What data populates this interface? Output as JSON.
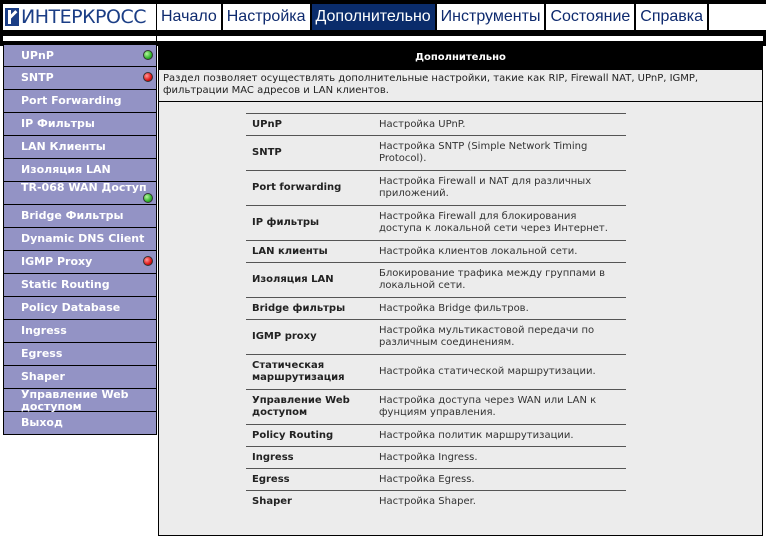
{
  "header": {
    "brand": "ИНТЕРКРОСС",
    "tabs": [
      {
        "label": "Начало",
        "active": false
      },
      {
        "label": "Настройка",
        "active": false
      },
      {
        "label": "Дополнительно",
        "active": true
      },
      {
        "label": "Инструменты",
        "active": false
      },
      {
        "label": "Состояние",
        "active": false
      },
      {
        "label": "Справка",
        "active": false
      }
    ]
  },
  "sidebar": {
    "items": [
      {
        "label": "UPnP",
        "status": "green"
      },
      {
        "label": "SNTP",
        "status": "red"
      },
      {
        "label": "Port Forwarding",
        "status": null
      },
      {
        "label": "IP Фильтры",
        "status": null
      },
      {
        "label": "LAN Клиенты",
        "status": null
      },
      {
        "label": "Изоляция LAN",
        "status": null
      },
      {
        "label": "TR-068 WAN Доступ",
        "status": "green"
      },
      {
        "label": "Bridge Фильтры",
        "status": null
      },
      {
        "label": "Dynamic DNS Client",
        "status": null
      },
      {
        "label": "IGMP Proxy",
        "status": "red"
      },
      {
        "label": "Static Routing",
        "status": null
      },
      {
        "label": "Policy Database",
        "status": null
      },
      {
        "label": "Ingress",
        "status": null
      },
      {
        "label": "Egress",
        "status": null
      },
      {
        "label": "Shaper",
        "status": null
      },
      {
        "label": "Управление Web доступом",
        "status": null
      },
      {
        "label": "Выход",
        "status": null
      }
    ]
  },
  "main": {
    "title": "Дополнительно",
    "description": "Раздел позволяет осуществлять дополнительные настройки, такие как RIP, Firewall NAT, UPnP, IGMP, фильтрации MAC адресов и LAN клиентов.",
    "features": [
      {
        "name": "UPnP",
        "desc": "Настройка UPnP."
      },
      {
        "name": "SNTP",
        "desc": "Настройка SNTP (Simple Network Timing Protocol)."
      },
      {
        "name": "Port forwarding",
        "desc": "Настройка Firewall и NAT для различных приложений."
      },
      {
        "name": "IP фильтры",
        "desc": "Настройка Firewall для блокирования доступа к локальной сети через Интернет."
      },
      {
        "name": "LAN клиенты",
        "desc": "Настройка клиентов локальной сети."
      },
      {
        "name": "Изоляция LAN",
        "desc": "Блокирование трафика между группами в локальной сети."
      },
      {
        "name": "Bridge фильтры",
        "desc": "Настройка Bridge фильтров."
      },
      {
        "name": "IGMP proxy",
        "desc": "Настройка мультикастовой передачи по различным соединениям."
      },
      {
        "name": "Статическая маршрутизация",
        "desc": "Настройка статической маршрутизации."
      },
      {
        "name": "Управление Web доступом",
        "desc": "Настройка доступа через WAN или LAN к фунциям управления."
      },
      {
        "name": "Policy Routing",
        "desc": "Настройка политик маршрутизации."
      },
      {
        "name": "Ingress",
        "desc": "Настройка Ingress."
      },
      {
        "name": "Egress",
        "desc": "Настройка Egress."
      },
      {
        "name": "Shaper",
        "desc": "Настройка Shaper."
      }
    ]
  }
}
